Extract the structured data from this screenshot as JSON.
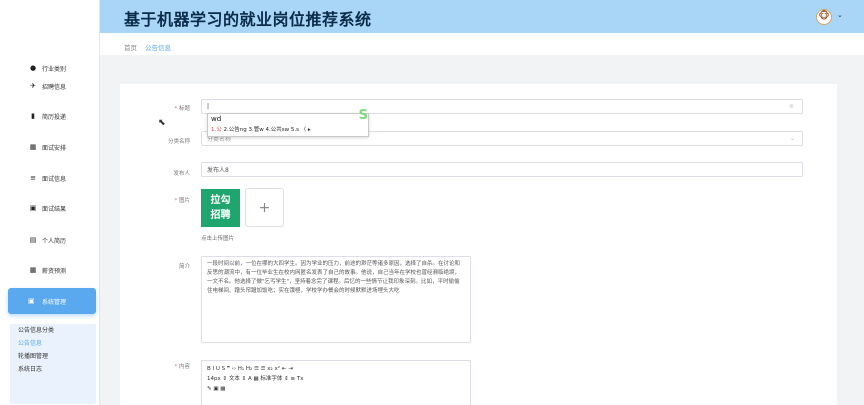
{
  "header": {
    "title": "基于机器学习的就业岗位推荐系统",
    "avatar_glyph": "🐵",
    "avatar_caret": "⌄"
  },
  "breadcrumb": {
    "home": "首页",
    "current": "公告信息"
  },
  "sidebar": {
    "items": [
      {
        "icon": "●",
        "label": "行业类别"
      },
      {
        "icon": "✈",
        "label": "招聘信息"
      },
      {
        "icon": "▮",
        "label": "简历投递"
      },
      {
        "icon": "▦",
        "label": "面试安排"
      },
      {
        "icon": "≡",
        "label": "面试信息"
      },
      {
        "icon": "▣",
        "label": "面试结果"
      },
      {
        "icon": "▤",
        "label": "个人简历"
      },
      {
        "icon": "▦",
        "label": "薪资预测"
      }
    ],
    "active": {
      "icon": "▣",
      "label": "系统管理"
    },
    "submenu": [
      "公告信息分类",
      "公告信息",
      "轮播图管理",
      "系统日志"
    ]
  },
  "form": {
    "title_label": "标题",
    "title_value": "|",
    "category_label": "分类名称",
    "category_placeholder": "分类名称",
    "publisher_label": "发布人",
    "publisher_value": "发布人8",
    "image_label": "图片",
    "image_logo_line1": "拉勾",
    "image_logo_line2": "招聘",
    "upload_plus": "+",
    "upload_hint": "点击上传图片",
    "intro_label": "简介",
    "intro_text": "一段时间以前，一位在哪的大四学生。因为学业的压力，前途的渺茫等诸多原因，选择了自杀。在讨论和反思的潮流中，有一位毕业生在校内网匿名发表了自己的故事。他说，自己当年在学校也曾经濒临绝境，一文不名。他选择了做\"乞丐学生\"，坚持着念完了课程。后忆的一些情节让我印象深刻。比如，平时偷偷住电梯间、蹭头帘蹭加饭吃；实在饿極，学校学办餐会的时候默默进场埋头大吃",
    "content_label": "内容",
    "editor_row1": "B  I  U  S   ❞  ‹›   H₁  H₂   ☰  ☰   x₂  x²   ⇤  ⇥",
    "editor_row2": "14px     ⇕    文本       ⇕    A  ▦    标准字体    ⇕    ≡    Tx",
    "editor_row3": "✎  ▣  ▦"
  },
  "ime": {
    "typed": "wd",
    "candidates_hl": "1.公",
    "candidates": " 2.公告ng  3.管w  4.公共sw  5.s  〈 ▸",
    "mark": "S"
  },
  "icons": {
    "clear": "⊗",
    "caret": "⌄",
    "cursor": "⬉"
  }
}
